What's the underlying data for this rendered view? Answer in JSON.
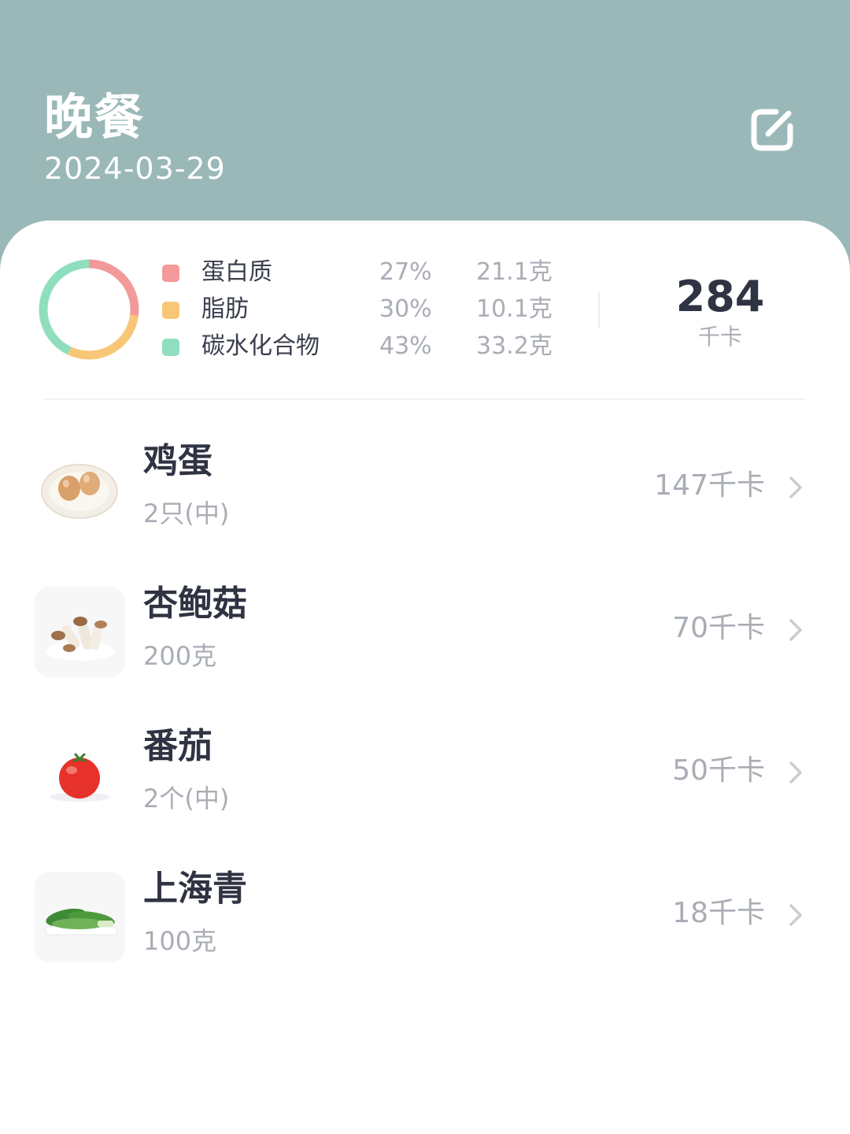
{
  "header": {
    "title": "晚餐",
    "date": "2024-03-29",
    "edit_icon": "edit-icon"
  },
  "summary": {
    "macros": [
      {
        "name": "蛋白质",
        "percent": "27%",
        "grams": "21.1克",
        "color": "#f29a99"
      },
      {
        "name": "脂肪",
        "percent": "30%",
        "grams": "10.1克",
        "color": "#f7c777"
      },
      {
        "name": "碳水化合物",
        "percent": "43%",
        "grams": "33.2克",
        "color": "#8fdfbf"
      }
    ],
    "total_value": "284",
    "total_unit": "千卡"
  },
  "chart_data": {
    "type": "pie",
    "categories": [
      "蛋白质",
      "脂肪",
      "碳水化合物"
    ],
    "values": [
      27,
      30,
      43
    ],
    "colors": [
      "#f29a99",
      "#f7c777",
      "#8fdfbf"
    ],
    "style": "donut"
  },
  "foods": [
    {
      "name": "鸡蛋",
      "amount": "2只(中)",
      "kcal": "147千卡",
      "icon": "egg-icon"
    },
    {
      "name": "杏鲍菇",
      "amount": "200克",
      "kcal": "70千卡",
      "icon": "mushroom-icon"
    },
    {
      "name": "番茄",
      "amount": "2个(中)",
      "kcal": "50千卡",
      "icon": "tomato-icon"
    },
    {
      "name": "上海青",
      "amount": "100克",
      "kcal": "18千卡",
      "icon": "bok-choy-icon"
    }
  ]
}
